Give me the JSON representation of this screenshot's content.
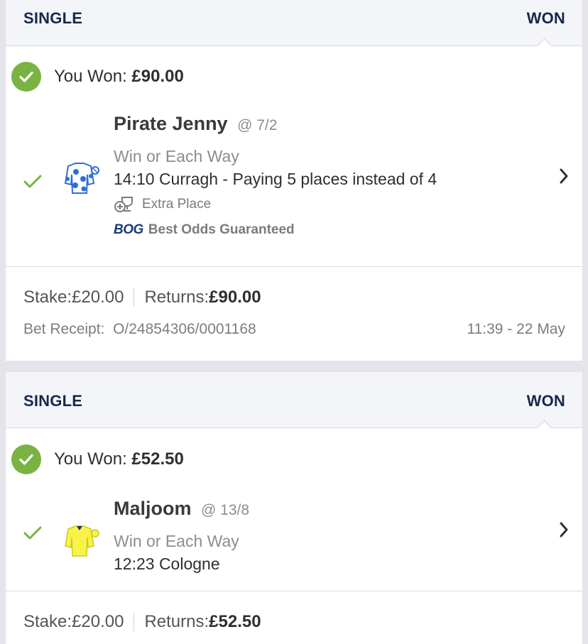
{
  "bets": [
    {
      "type": "SINGLE",
      "status": "WON",
      "won_label": "You Won:",
      "won_amount": "£90.00",
      "runner": "Pirate Jenny",
      "odds": "@ 7/2",
      "market": "Win or Each Way",
      "event": "14:10 Curragh - Paying 5 places instead of 4",
      "extra_place": "Extra Place",
      "bog_logo": "BOG",
      "bog_text": "Best Odds Guaranteed",
      "stake_label": "Stake:",
      "stake": "£20.00",
      "returns_label": "Returns:",
      "returns": "£90.00",
      "receipt_label": "Bet Receipt:",
      "receipt": "O/24854306/0001168",
      "time": "11:39 - 22 May",
      "silks_colors": [
        "#ffffff",
        "#2d6fd6"
      ]
    },
    {
      "type": "SINGLE",
      "status": "WON",
      "won_label": "You Won:",
      "won_amount": "£52.50",
      "runner": "Maljoom",
      "odds": "@ 13/8",
      "market": "Win or Each Way",
      "event": "12:23 Cologne",
      "stake_label": "Stake:",
      "stake": "£20.00",
      "returns_label": "Returns:",
      "returns": "£52.50",
      "silks_colors": [
        "#f7f34a",
        "#1c2f6b"
      ]
    }
  ],
  "colors": {
    "win_green": "#7ab342",
    "header_navy": "#17294a",
    "bog_blue": "#1d3a78"
  }
}
